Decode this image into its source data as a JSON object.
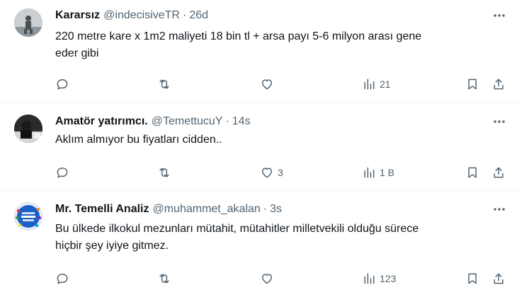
{
  "tweets": [
    {
      "name": "Kararsız",
      "handle": "@indecisiveTR",
      "time": "26d",
      "lines": [
        "220 metre kare x 1m2 maliyeti 18 bin tl + arsa payı 5-6 milyon arası gene",
        "eder gibi"
      ],
      "replies": "",
      "reposts": "",
      "likes": "",
      "views": "21",
      "avatar_color": "#9aa3a8"
    },
    {
      "name": "Amatör yatırımcı.",
      "handle": "@TemettucuY",
      "time": "14s",
      "lines": [
        "Aklım almıyor bu fiyatları cidden.."
      ],
      "replies": "",
      "reposts": "",
      "likes": "3",
      "views": "1 B",
      "avatar_color": "#3a3a3a"
    },
    {
      "name": "Mr. Temelli Analiz",
      "handle": "@muhammet_akalan",
      "time": "3s",
      "lines": [
        "Bu ülkede ilkokul mezunları mütahit, mütahitler milletvekili olduğu sürece",
        "hiçbir şey iyiye gitmez."
      ],
      "replies": "",
      "reposts": "",
      "likes": "",
      "views": "123",
      "avatar_color": "#1d6fd8"
    }
  ],
  "separator": "·",
  "icons": {
    "more": "more-icon",
    "reply": "reply-icon",
    "repost": "repost-icon",
    "like": "like-icon",
    "views": "views-icon",
    "bookmark": "bookmark-icon",
    "share": "share-icon"
  },
  "colors": {
    "text": "#0f1419",
    "secondary": "#536471",
    "divider": "#eff3f4"
  }
}
